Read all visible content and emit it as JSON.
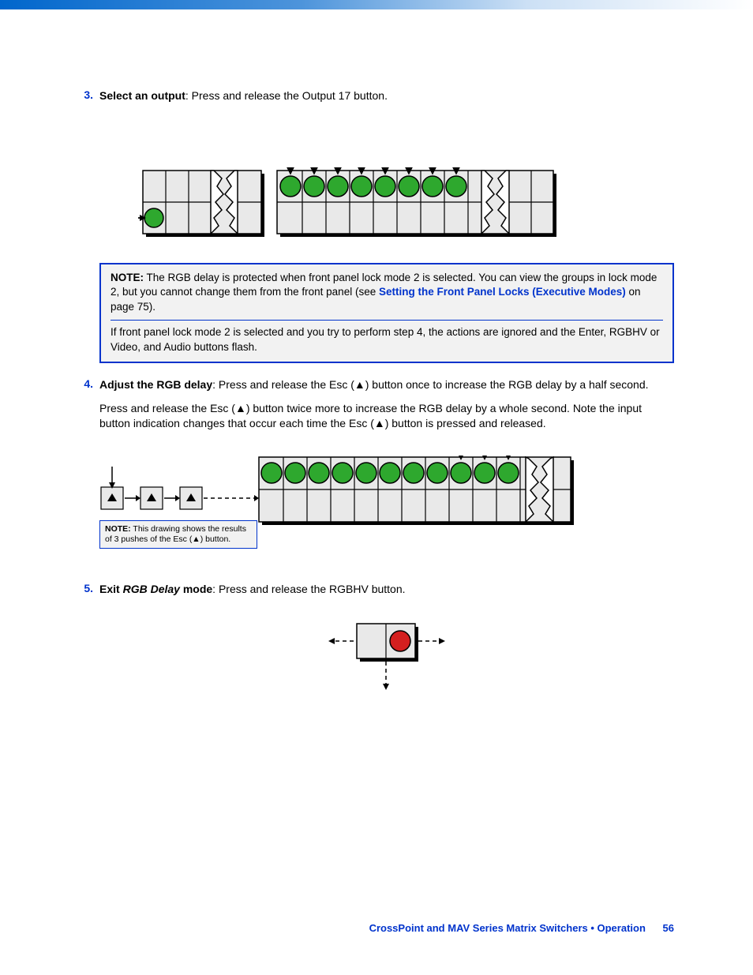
{
  "steps": {
    "s3": {
      "num": "3.",
      "title": "Select an output",
      "rest": ": Press and release the Output 17 button."
    },
    "s4": {
      "num": "4.",
      "title": "Adjust the RGB delay",
      "rest": ": Press and release the Esc (▲) button once to increase the RGB delay by a half second.",
      "para2": "Press and release the Esc (▲) button twice more to increase the RGB delay by a whole second. Note the input button indication changes that occur each time the Esc (▲) button is pressed and released."
    },
    "s5": {
      "num": "5.",
      "title_a": "Exit ",
      "title_b": "RGB Delay",
      "title_c": " mode",
      "rest": ": Press and release the RGBHV button."
    }
  },
  "note1": {
    "label": "NOTE:",
    "p1a": "The RGB delay is protected when front panel lock mode 2 is selected. You can view the groups in lock mode 2, but you cannot change them from the front panel (see ",
    "link": "Setting the Front Panel Locks (Executive Modes)",
    "p1b": " on page 75).",
    "p2": "If front panel lock mode 2 is selected and you try to perform step 4, the actions are ignored and the Enter, RGBHV or Video, and Audio buttons flash."
  },
  "mini_note": {
    "label": "NOTE:",
    "text": "This drawing shows the results of 3 pushes of the Esc (▲) button."
  },
  "footer": {
    "text": "CrossPoint and MAV Series Matrix Switchers • Operation",
    "page": "56"
  }
}
